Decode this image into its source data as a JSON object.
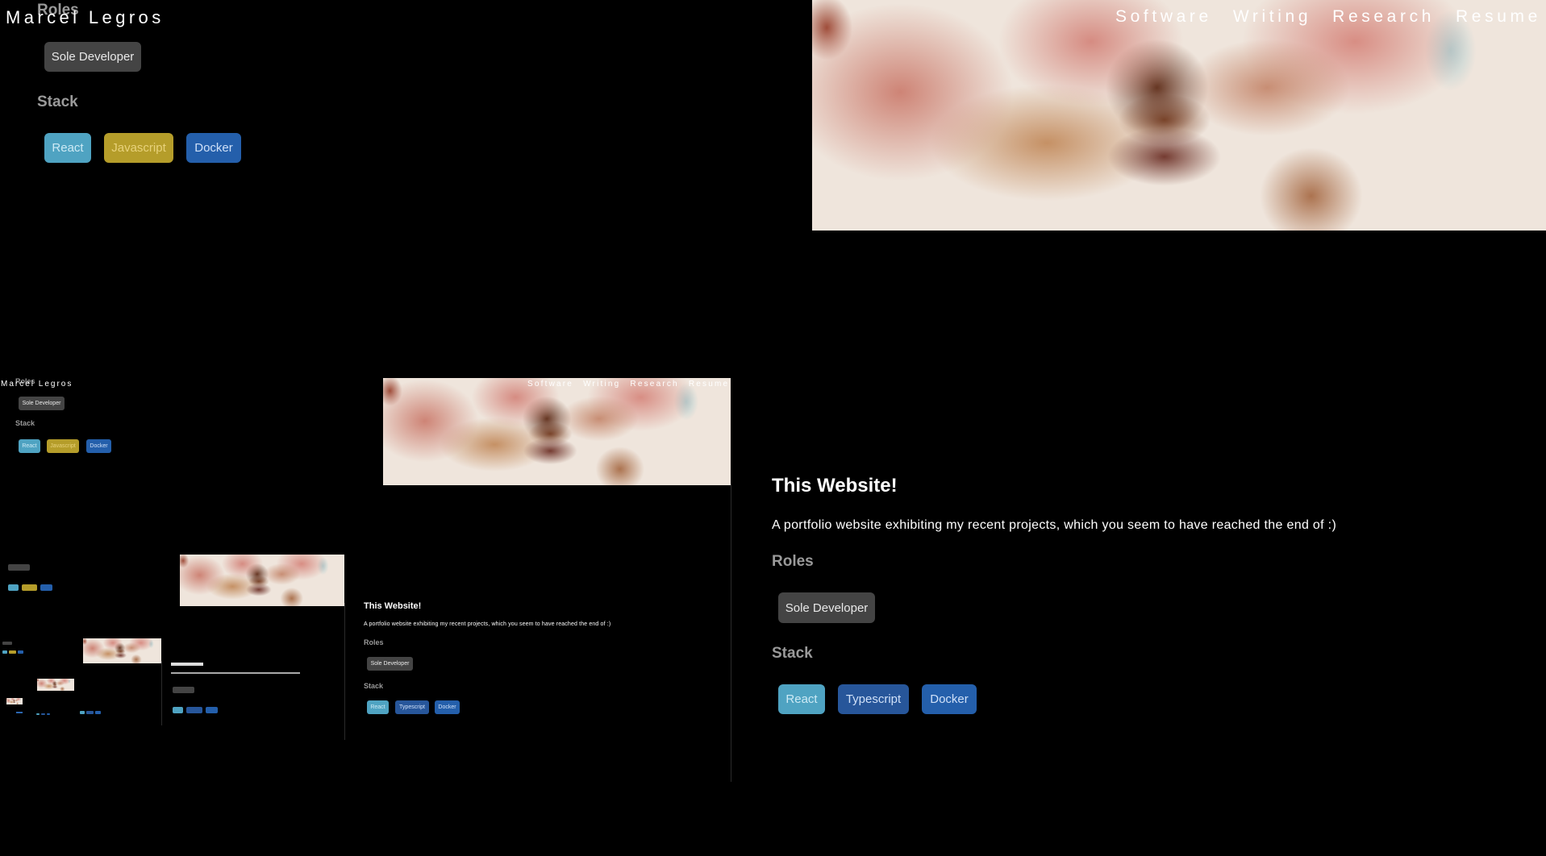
{
  "site": {
    "name": "Marcel Legros",
    "nav": [
      "Software",
      "Writing",
      "Research",
      "Resume"
    ]
  },
  "previous_project": {
    "roles_label": "Roles",
    "roles": [
      "Sole Developer"
    ],
    "stack_label": "Stack",
    "stack": [
      "React",
      "Javascript",
      "Docker"
    ]
  },
  "project": {
    "title": "This Website!",
    "description": "A portfolio website exhibiting my recent projects, which you seem to have reached the end of :)",
    "roles_label": "Roles",
    "roles": [
      "Sole Developer"
    ],
    "stack_label": "Stack",
    "stack": [
      "React",
      "Typescript",
      "Docker"
    ]
  },
  "colors": {
    "background": "#000000",
    "react": "#4fa3c2",
    "javascript": "#b59d2a",
    "docker": "#245fab",
    "typescript": "#27569a",
    "role": "#444444"
  }
}
